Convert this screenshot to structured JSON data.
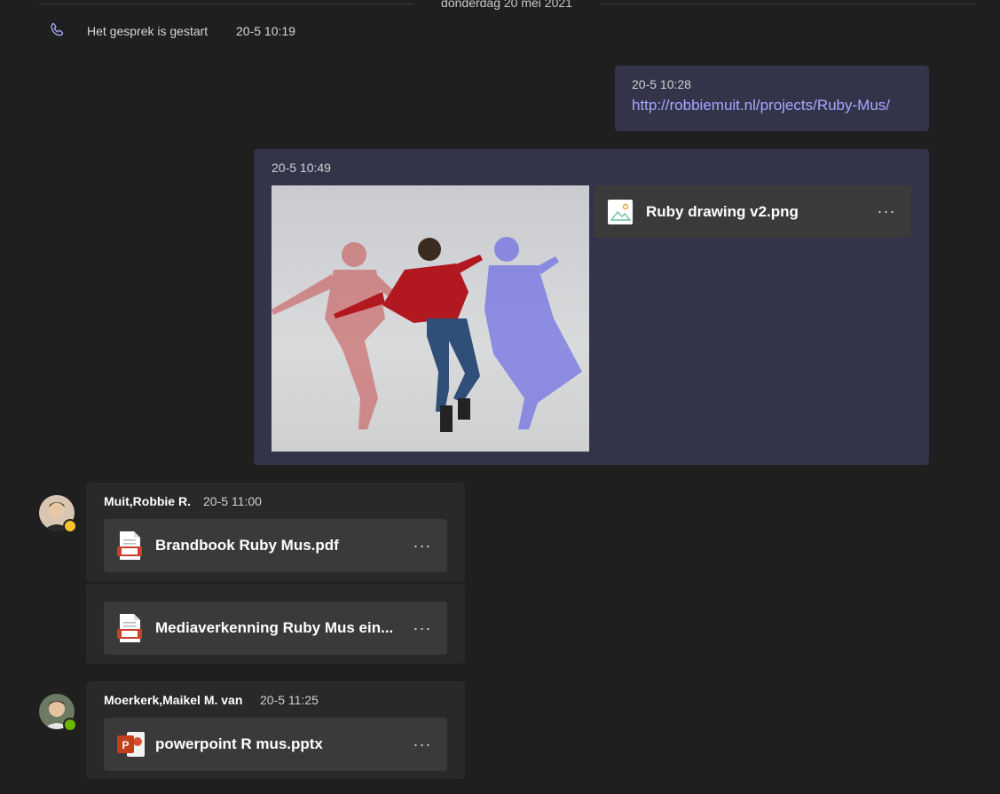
{
  "date_separator": "donderdag 20 mei 2021",
  "call_event": {
    "text": "Het gesprek is gestart",
    "time": "20-5 10:19",
    "icon": "phone-icon"
  },
  "my_messages": [
    {
      "time": "20-5 10:28",
      "link": "http://robbiemuit.nl/projects/Ruby-Mus/"
    },
    {
      "time": "20-5 10:49",
      "attachment": {
        "name": "Ruby drawing v2.png",
        "icon": "image-file-icon"
      }
    }
  ],
  "other_messages": [
    {
      "sender": "Muit,Robbie R.",
      "time": "20-5 11:00",
      "presence": "away",
      "attachments": [
        {
          "name": "Brandbook Ruby Mus.pdf",
          "icon": "pdf-file-icon"
        },
        {
          "name": "Mediaverkenning Ruby Mus ein...",
          "icon": "pdf-file-icon"
        }
      ]
    },
    {
      "sender": "Moerkerk,Maikel M. van",
      "time": "20-5 11:25",
      "presence": "available",
      "attachments": [
        {
          "name": "powerpoint R mus.pptx",
          "icon": "powerpoint-file-icon"
        }
      ]
    }
  ],
  "more_label": "···",
  "colors": {
    "bubble_me": "#33344a",
    "link": "#a6a8ff",
    "away": "#f8c22b",
    "available": "#6bb700"
  }
}
